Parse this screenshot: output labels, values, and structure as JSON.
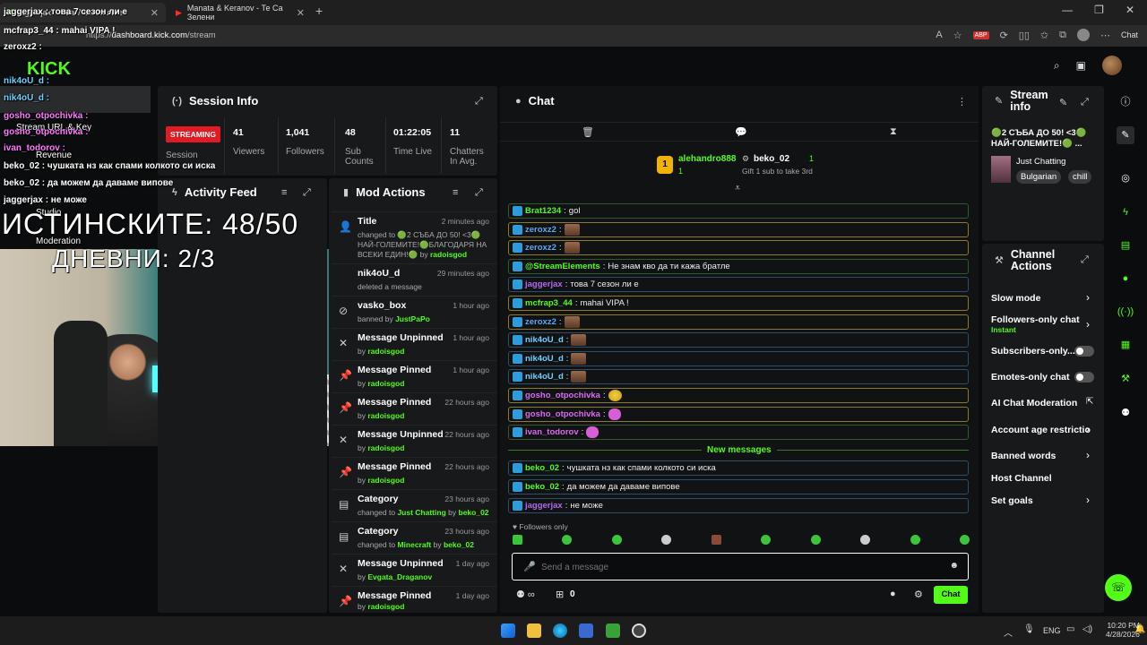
{
  "browser": {
    "tab1_title": "jaggerjax : това 7 сезон ли е",
    "tab2_title": "Manata & Keranov - Те Са Зелени",
    "url_prefix": "https://",
    "url_host": "dashboard.kick.com",
    "url_path": "/stream",
    "chat_button": "Chat"
  },
  "session": {
    "title": "Session Info",
    "status": "STREAMING",
    "status_label": "Session",
    "stats": [
      {
        "value": "41",
        "label": "Viewers"
      },
      {
        "value": "1,041",
        "label": "Followers"
      },
      {
        "value": "48",
        "label": "Sub Counts"
      },
      {
        "value": "01:22:05",
        "label": "Time Live"
      },
      {
        "value": "11",
        "label": "Chatters In Avg."
      }
    ]
  },
  "activity": {
    "title": "Activity Feed"
  },
  "mod": {
    "title": "Mod Actions",
    "rows": [
      {
        "title": "Title",
        "time": "2 minutes ago",
        "sub": "changed to 🟢2 СЪБА ДО 50! <3🟢 НАЙ-ГОЛЕМИТЕ!🟢БЛАГОДАРЯ НА ВСЕКИ ЕДИН!🟢 by",
        "by": "radoisgod"
      },
      {
        "title": "nik4oU_d",
        "time": "29 minutes ago",
        "sub": "deleted a message",
        "by": ""
      },
      {
        "title": "vasko_box",
        "time": "1 hour ago",
        "sub": "banned by",
        "by": "JustPaPo"
      },
      {
        "title": "Message Unpinned",
        "time": "1 hour ago",
        "sub": "by",
        "by": "radoisgod"
      },
      {
        "title": "Message Pinned",
        "time": "1 hour ago",
        "sub": "by",
        "by": "radoisgod"
      },
      {
        "title": "Message Pinned",
        "time": "22 hours ago",
        "sub": "by",
        "by": "radoisgod"
      },
      {
        "title": "Message Unpinned",
        "time": "22 hours ago",
        "sub": "by",
        "by": "radoisgod"
      },
      {
        "title": "Message Pinned",
        "time": "22 hours ago",
        "sub": "by",
        "by": "radoisgod"
      },
      {
        "title": "Category",
        "time": "23 hours ago",
        "sub": "changed to",
        "by": "Just Chatting",
        "by2": "beko_02"
      },
      {
        "title": "Category",
        "time": "23 hours ago",
        "sub": "changed to",
        "by": "Minecraft",
        "by2": "beko_02"
      },
      {
        "title": "Message Unpinned",
        "time": "1 day ago",
        "sub": "by",
        "by": "Evgata_Draganov"
      },
      {
        "title": "Message Pinned",
        "time": "1 day ago",
        "sub": "by",
        "by": "radoisgod"
      }
    ]
  },
  "chat": {
    "title": "Chat",
    "top_gifter": "alehandro888",
    "top_gifter_count": "1",
    "second_user": "beko_02",
    "second_count": "1",
    "gift_text": "Gift 1 sub to take 3rd",
    "messages": [
      {
        "user": "Brat1234",
        "text": "gol",
        "color": "green",
        "style": "green"
      },
      {
        "user": "zeroxz2",
        "text": "",
        "color": "blue",
        "style": "gold"
      },
      {
        "user": "zeroxz2",
        "text": "",
        "color": "blue",
        "style": "gold"
      },
      {
        "user": "@StreamElements",
        "text": "Не знам кво да ти кажа братле",
        "color": "green",
        "style": "green"
      },
      {
        "user": "jaggerjax",
        "text": "това 7 сезон ли е",
        "color": "purple",
        "style": "blue"
      },
      {
        "user": "mcfrap3_44",
        "text": "mahai VIPA !",
        "color": "green",
        "style": "gold"
      },
      {
        "user": "zeroxz2",
        "text": "",
        "color": "blue",
        "style": "gold"
      },
      {
        "user": "nik4oU_d",
        "text": "",
        "color": "teal",
        "style": "blue"
      },
      {
        "user": "nik4oU_d",
        "text": "",
        "color": "teal",
        "style": "blue"
      },
      {
        "user": "nik4oU_d",
        "text": "",
        "color": "teal",
        "style": "blue"
      },
      {
        "user": "gosho_otpochivka",
        "text": "",
        "color": "pink",
        "style": "gold"
      },
      {
        "user": "gosho_otpochivka",
        "text": "",
        "color": "pink",
        "style": "gold"
      },
      {
        "user": "ivan_todorov",
        "text": "",
        "color": "pink",
        "style": "green"
      }
    ],
    "new_messages_label": "New messages",
    "new_messages": [
      {
        "user": "beko_02",
        "text": "чушката нз как спами колкото си иска"
      },
      {
        "user": "beko_02",
        "text": "да можем да даваме випове"
      },
      {
        "user": "jaggerjax",
        "text": "не може"
      }
    ],
    "followers_only": "Followers only",
    "placeholder": "Send a message",
    "send_label": "Chat",
    "points": "0"
  },
  "overlay": {
    "big1": "ИСТИНСКИТЕ: 48/50",
    "big2": "ДНЕВНИ: 2/3",
    "lines": [
      "jaggerjax : това 7 сезон ли е",
      "mcfrap3_44 : mahai VIPA !",
      "zeroxz2 :",
      "nik4oU_d :",
      "nik4oU_d :",
      "gosho_otpochivka :",
      "gosho_otpochivka :",
      "ivan_todorov :",
      "beko_02 : чушката нз как спами колкото си иска",
      "beko_02 : да можем да даваме випове",
      "jaggerjax : не може"
    ],
    "menu": [
      "Stream URL & Key",
      "Revenue",
      "Studio",
      "Moderation"
    ]
  },
  "stream_info": {
    "title": "Stream info",
    "stream_title": "🟢2 СЪБА ДО 50! <3🟢 НАЙ-ГОЛЕМИТЕ!🟢 ...",
    "category": "Just Chatting",
    "tags": [
      "Bulgarian",
      "chill"
    ]
  },
  "channel_actions": {
    "title": "Channel Actions",
    "items": [
      {
        "label": "Slow mode",
        "control": "chevron"
      },
      {
        "label": "Followers-only chat",
        "sub": "Instant",
        "control": "chevron"
      },
      {
        "label": "Subscribers-only...",
        "control": "toggle"
      },
      {
        "label": "Emotes-only chat",
        "control": "toggle"
      },
      {
        "label": "AI Chat Moderation",
        "control": "external"
      },
      {
        "label": "Account age restrictio",
        "control": "chevron"
      },
      {
        "label": "Banned words",
        "control": "chevron"
      },
      {
        "label": "Host Channel",
        "control": "none"
      },
      {
        "label": "Set goals",
        "control": "chevron"
      }
    ]
  },
  "taskbar": {
    "lang": "ENG",
    "time": "10:20 PM",
    "date": "4/28/2026"
  }
}
